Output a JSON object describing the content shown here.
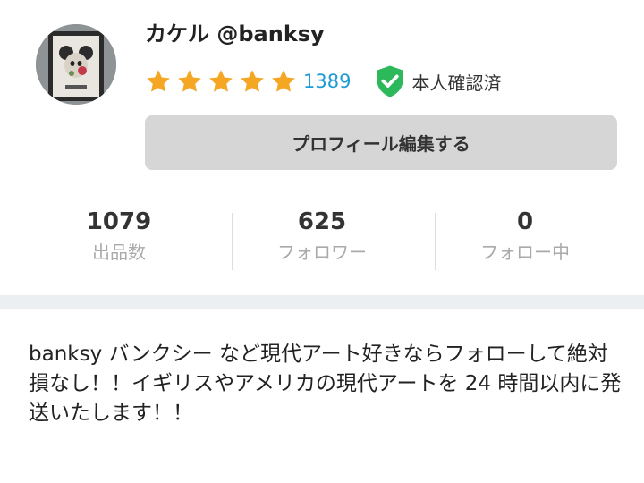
{
  "profile": {
    "display_name": "カケル @banksy",
    "avatar_icon": "framed-mouse-art-avatar",
    "rating": {
      "stars": 5,
      "max_stars": 5,
      "count": "1389",
      "star_color": "#f5a623"
    },
    "verified": {
      "label": "本人確認済",
      "icon": "shield-check-icon",
      "color": "#2eb85c"
    },
    "edit_button_label": "プロフィール編集する"
  },
  "stats": [
    {
      "value": "1079",
      "label": "出品数"
    },
    {
      "value": "625",
      "label": "フォロワー"
    },
    {
      "value": "0",
      "label": "フォロー中"
    }
  ],
  "bio": "banksy バンクシー など現代アート好きならフォローして絶対損なし！！イギリスやアメリカの現代アートを 24 時間以内に発送いたします！！"
}
